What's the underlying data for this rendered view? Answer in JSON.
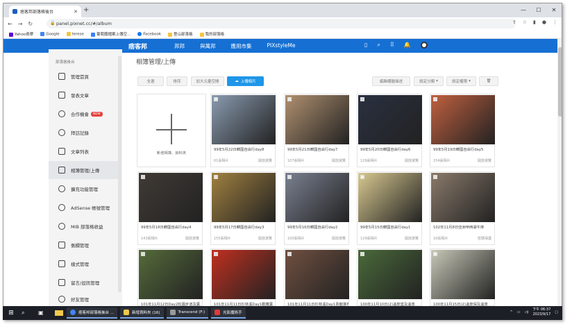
{
  "browser": {
    "tab_title": "痞客邦部落格後台",
    "url": "panel.pixnet.cc/#/album",
    "bookmarks": [
      "Yahoo奇摩",
      "Google",
      "terese",
      "葡萄醬檔案上傳空...",
      "Facebook",
      "登山部落格",
      "我的部落格"
    ]
  },
  "header": {
    "logo": "痞客邦",
    "nav": [
      "邦邦",
      "與萬邦",
      "應用市集",
      "PIXstyleMe"
    ]
  },
  "sidebar": {
    "title": "部落格後台",
    "new_badge": "NEW",
    "items": [
      {
        "label": "管理首頁",
        "icon": "home-icon"
      },
      {
        "label": "發表文章",
        "icon": "edit-icon"
      },
      {
        "label": "合作機會",
        "icon": "handshake-icon"
      },
      {
        "label": "拜訪記錄",
        "icon": "footprint-icon"
      },
      {
        "label": "文章列表",
        "icon": "list-icon"
      },
      {
        "label": "相簿管理/上傳",
        "icon": "image-icon"
      },
      {
        "label": "擴充功能管理",
        "icon": "puzzle-icon"
      },
      {
        "label": "AdSense 帳號管理",
        "icon": "dollar-icon"
      },
      {
        "label": "MIB 部落格收益",
        "icon": "money-icon"
      },
      {
        "label": "側欄管理",
        "icon": "sidebar-icon"
      },
      {
        "label": "樣式管理",
        "icon": "palette-icon"
      },
      {
        "label": "留言/迴訊管理",
        "icon": "comment-icon"
      },
      {
        "label": "好友管理",
        "icon": "friends-icon"
      }
    ]
  },
  "main": {
    "title": "相簿管理/上傳",
    "toolbar": {
      "select_all": "全選",
      "sort": "排序",
      "add_large_capacity": "加大元量空間",
      "upload": "上傳相片",
      "edit_desc": "編輯標題描述",
      "set_category": "設定分類",
      "set_permission": "設定權限"
    },
    "new_album_label": "新增相簿、資料夾",
    "albums": [
      {
        "title": "99年5月22日韓國自由行day8",
        "count": "61張相片",
        "perm": "開放瀏覽",
        "color": "#8a9bb0"
      },
      {
        "title": "99年5月21日韓國自由行day7",
        "count": "107張相片",
        "perm": "開放瀏覽",
        "color": "#b09070"
      },
      {
        "title": "99年5月20日韓國自由行day6",
        "count": "129張相片",
        "perm": "開放瀏覽",
        "color": "#2a3040"
      },
      {
        "title": "99年5月19日韓國自由行day5",
        "count": "154張相片",
        "perm": "開放瀏覽",
        "color": "#c06040"
      },
      {
        "title": "99年5月18日韓國自由行day4",
        "count": "143張相片",
        "perm": "開放瀏覽",
        "color": "#403a35"
      },
      {
        "title": "99年5月17日韓國自由行day3",
        "count": "155張相片",
        "perm": "開放瀏覽",
        "color": "#a08040"
      },
      {
        "title": "99年5月16日韓國自由行day2",
        "count": "100張相片",
        "perm": "開放瀏覽",
        "color": "#7a8090"
      },
      {
        "title": "99年5月15日韓國自由行day1",
        "count": "129張相片",
        "perm": "開放瀏覽",
        "color": "#d8c890"
      },
      {
        "title": "102年11月8日亞洲甲西湖牛排",
        "count": "16張相片",
        "perm": "密碼保護",
        "color": "#8a7a6a"
      },
      {
        "title": "101年11月12日Day2松園步道及葉",
        "count": "",
        "perm": "",
        "color": "#556b3a"
      },
      {
        "title": "101年11月11日杉林溪Day1觀蘿葉",
        "count": "",
        "perm": "",
        "color": "#c03020"
      },
      {
        "title": "101年11月11日杉林溪Day1青龍瀑布",
        "count": "",
        "perm": "",
        "color": "#705040"
      },
      {
        "title": "100年11月10日(2)溫泉堡及溫泉",
        "count": "",
        "perm": "",
        "color": "#4a6a3a"
      },
      {
        "title": "100年11月15日(2)溫泉保及溫泉",
        "count": "",
        "perm": "",
        "color": "#c8c8b8"
      }
    ]
  },
  "taskbar": {
    "apps": [
      "痞客邦部落格後台 ...",
      "新增資料夾 (16)",
      "Transcend (F:)",
      "光影魔術手"
    ],
    "time": "下午 06:37",
    "date": "2023/9/17"
  }
}
